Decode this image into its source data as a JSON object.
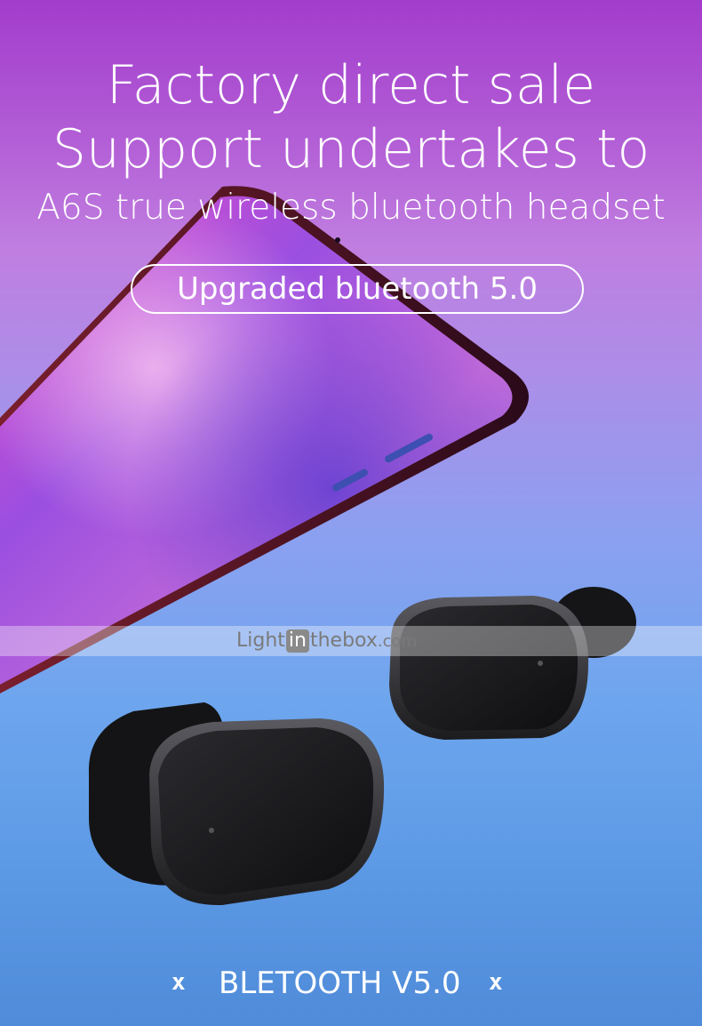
{
  "headline": {
    "line1": "Factory direct sale",
    "line2": "Support undertakes to",
    "line3": "A6S true wireless bluetooth headset"
  },
  "badge": {
    "label": "Upgraded bluetooth 5.0"
  },
  "watermark": {
    "prefix": "Light",
    "highlight": "in",
    "suffix": "thebox",
    "tld": ".com"
  },
  "footer": {
    "label": "BLETOOTH V5.0",
    "left_mark": "x",
    "right_mark": "x"
  },
  "colors": {
    "text": "#ffffff",
    "earbud": "#1a1a1c",
    "background_top": "#a23ccc",
    "background_bottom": "#4f8bd8"
  }
}
